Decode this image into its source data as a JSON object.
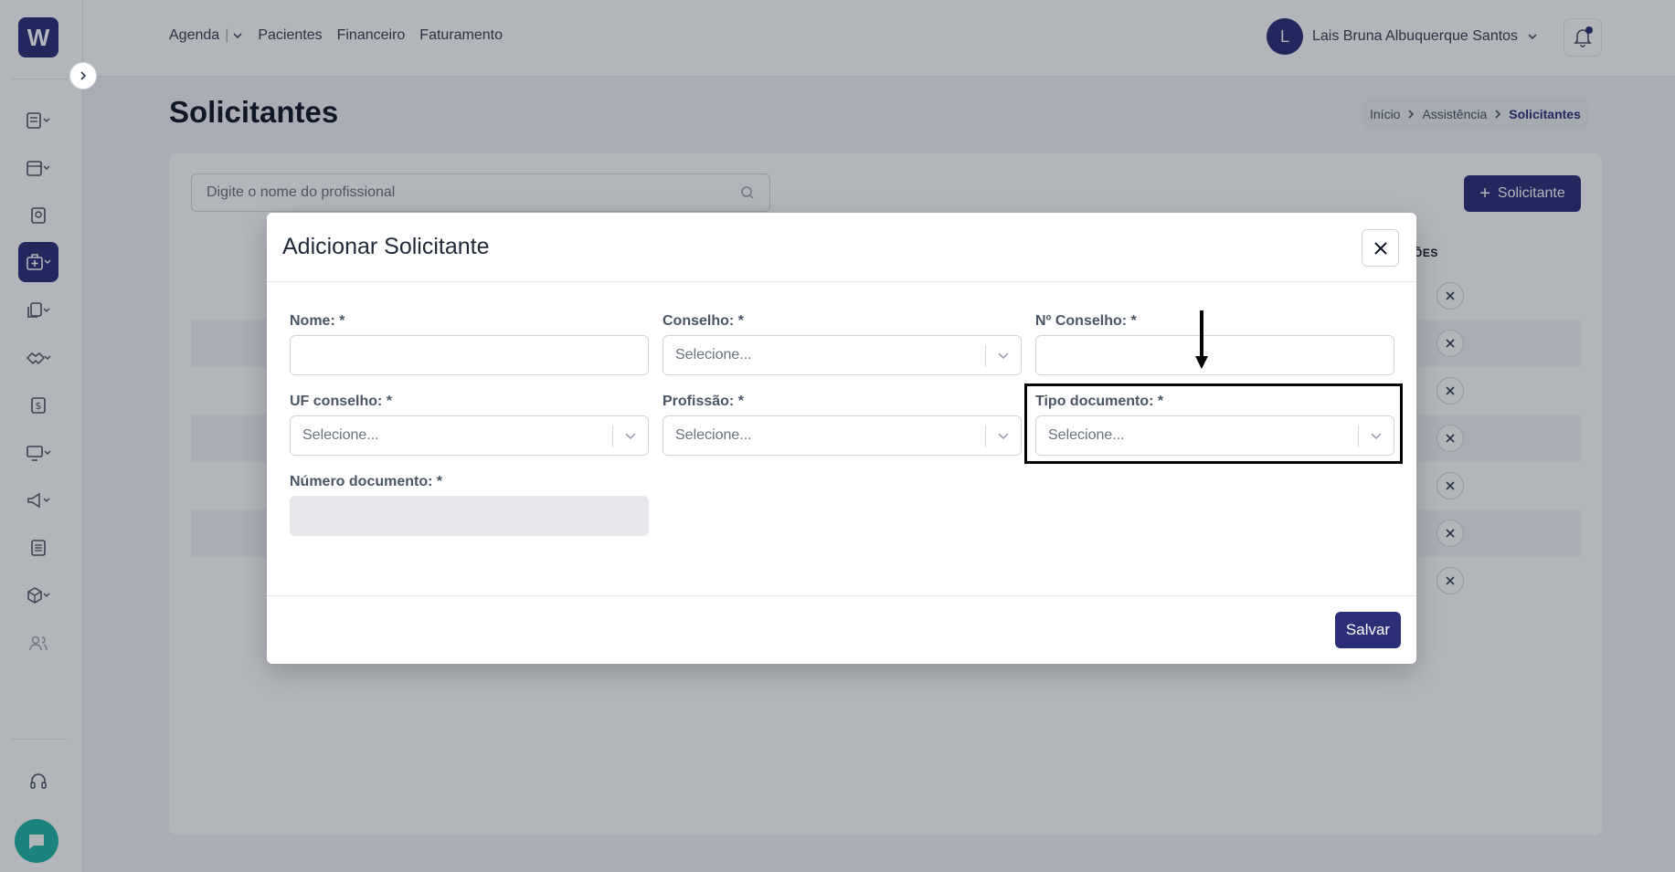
{
  "sidebar": {
    "logo_text": "W",
    "icons": [
      "list-icon",
      "calendar-icon",
      "id-badge-icon",
      "medical-bag-icon",
      "documents-icon",
      "handshake-icon",
      "dollar-icon",
      "monitor-icon",
      "megaphone-icon",
      "newspaper-icon",
      "box-icon",
      "users-icon"
    ],
    "support_icon": "headset-icon",
    "chat_icon": "chat-icon"
  },
  "topnav": {
    "items": [
      "Agenda",
      "Pacientes",
      "Financeiro",
      "Faturamento"
    ],
    "separator": "|"
  },
  "user": {
    "initial": "L",
    "name": "Lais Bruna Albuquerque Santos"
  },
  "page": {
    "title": "Solicitantes",
    "breadcrumb": [
      "Início",
      "Assistência",
      "Solicitantes"
    ]
  },
  "list": {
    "search_placeholder": "Digite o nome do profissional",
    "add_button": "Solicitante",
    "actions_header": "ÕES"
  },
  "modal": {
    "title": "Adicionar Solicitante",
    "fields": {
      "nome": {
        "label": "Nome: *",
        "value": ""
      },
      "conselho": {
        "label": "Conselho: *",
        "placeholder": "Selecione..."
      },
      "num_conselho": {
        "label": "Nº Conselho: *",
        "value": ""
      },
      "uf_conselho": {
        "label": "UF conselho: *",
        "placeholder": "Selecione..."
      },
      "profissao": {
        "label": "Profissão: *",
        "placeholder": "Selecione..."
      },
      "tipo_documento": {
        "label": "Tipo documento: *",
        "placeholder": "Selecione..."
      },
      "numero_documento": {
        "label": "Número documento: *",
        "value": ""
      }
    },
    "save_button": "Salvar"
  }
}
